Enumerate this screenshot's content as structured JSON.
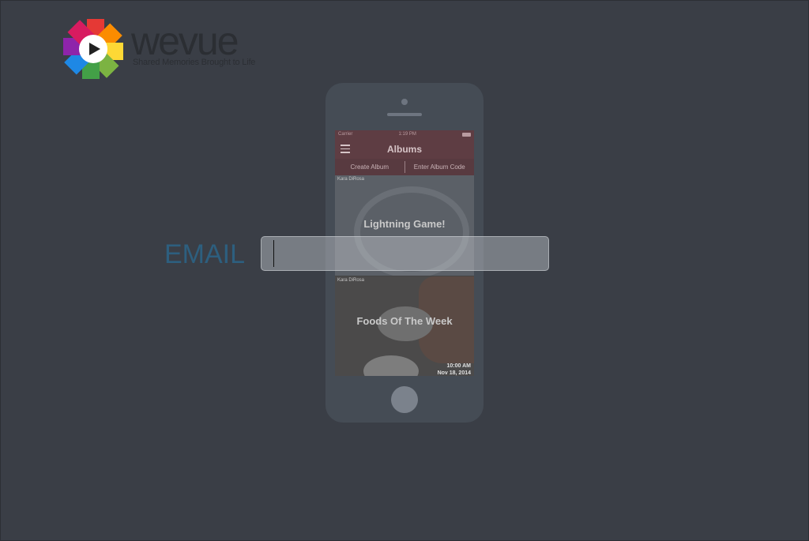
{
  "brand": {
    "name_we": "we",
    "name_vue": "vue",
    "tagline": "Shared Memories Brought to Life",
    "colors": [
      "#e53935",
      "#fb8c00",
      "#fdd835",
      "#43a047",
      "#1e88e5",
      "#8e24aa",
      "#d81b60"
    ]
  },
  "phone": {
    "status": {
      "carrier": "Carrier",
      "time": "1:19 PM"
    },
    "nav_title": "Albums",
    "actions": {
      "create": "Create Album",
      "enter": "Enter Album Code"
    },
    "albums": [
      {
        "owner": "Kara DiRosa",
        "title": "Lightning Game!",
        "time": "",
        "date": ""
      },
      {
        "owner": "Kara DiRosa",
        "title": "Foods Of The Week",
        "time": "10:00 AM",
        "date": "Nov 18, 2014"
      }
    ]
  },
  "form": {
    "email_label": "EMAIL",
    "email_value": "",
    "email_placeholder": ""
  }
}
